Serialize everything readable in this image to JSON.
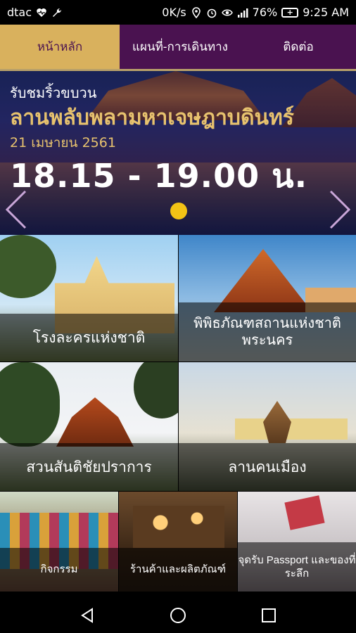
{
  "status_bar": {
    "carrier": "dtac",
    "net_speed": "0K/s",
    "battery": "76%",
    "battery_plus": "+",
    "time": "9:25 AM",
    "icons": [
      "heart-monitor-icon",
      "wrench-icon",
      "location-icon",
      "alarm-icon",
      "eye-icon",
      "signal-icon",
      "battery-icon"
    ]
  },
  "tabs": [
    {
      "label": "หน้าหลัก",
      "active": true
    },
    {
      "label": "แผนที่-การเดินทาง",
      "active": false
    },
    {
      "label": "ติดต่อ",
      "active": false
    }
  ],
  "banner": {
    "kicker": "รับชมริ้วขบวน",
    "title": "ลานพลับพลามหาเจษฎาบดินทร์",
    "date": "21 เมษายน 2561",
    "time": "18.15 - 19.00 น.",
    "slide_index": 1,
    "slide_count": 1
  },
  "tiles": [
    {
      "label": "โรงละครแห่งชาติ"
    },
    {
      "label": "พิพิธภัณฑสถานแห่งชาติ พระนคร"
    },
    {
      "label": "สวนสันติชัยปราการ"
    },
    {
      "label": "ลานคนเมือง"
    },
    {
      "label": "กิจกรรม"
    },
    {
      "label": "ร้านค้าและผลิตภัณฑ์"
    },
    {
      "label": "จุดรับ Passport และของที่ระลึก"
    }
  ],
  "nav": {
    "icons": [
      "back-icon",
      "home-icon",
      "recents-icon"
    ]
  },
  "colors": {
    "tab_bg": "#4a1250",
    "tab_active": "#d9b15d",
    "gold_text": "#e7c26e",
    "dot": "#f3c315"
  }
}
